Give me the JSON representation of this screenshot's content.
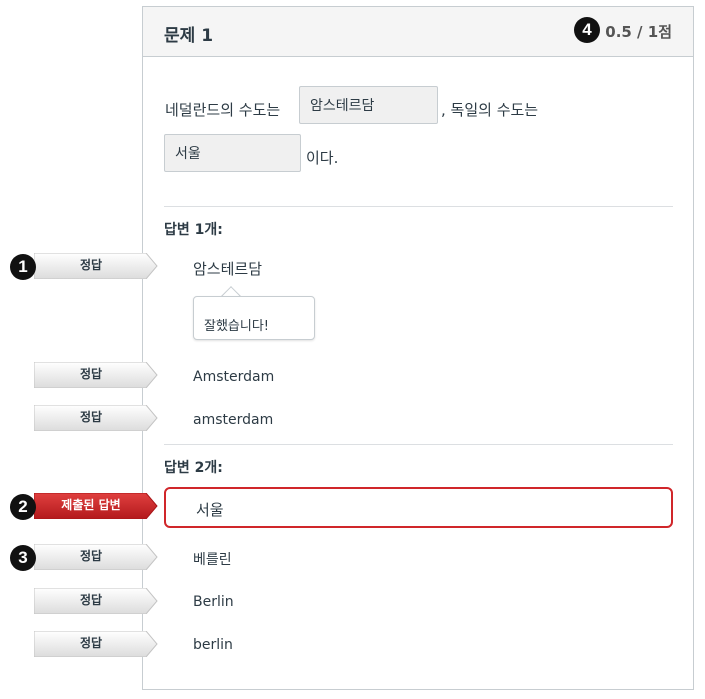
{
  "question": {
    "title": "문제 1",
    "score": "0.5 / 1점"
  },
  "sentence": {
    "part1": "네덜란드의 수도는",
    "blank1": "암스테르담",
    "part2": ", 독일의 수도는",
    "blank2": "서울",
    "part3": "이다."
  },
  "groups": [
    {
      "title": "답변 1개:",
      "answers": [
        {
          "tag": "정답",
          "text": "암스테르담"
        },
        {
          "tag": "정답",
          "text": "Amsterdam"
        },
        {
          "tag": "정답",
          "text": "amsterdam"
        }
      ],
      "feedback": "잘했습니다!"
    },
    {
      "title": "답변 2개:",
      "submitted": {
        "tag": "제출된 답변",
        "text": "서울"
      },
      "answers": [
        {
          "tag": "정답",
          "text": "베를린"
        },
        {
          "tag": "정답",
          "text": "Berlin"
        },
        {
          "tag": "정답",
          "text": "berlin"
        }
      ]
    }
  ],
  "callouts": [
    "1",
    "2",
    "3",
    "4"
  ],
  "colors": {
    "submitted_red": "#d0262a",
    "tag_gray": "#e6e6e6",
    "badge": "#111111"
  }
}
